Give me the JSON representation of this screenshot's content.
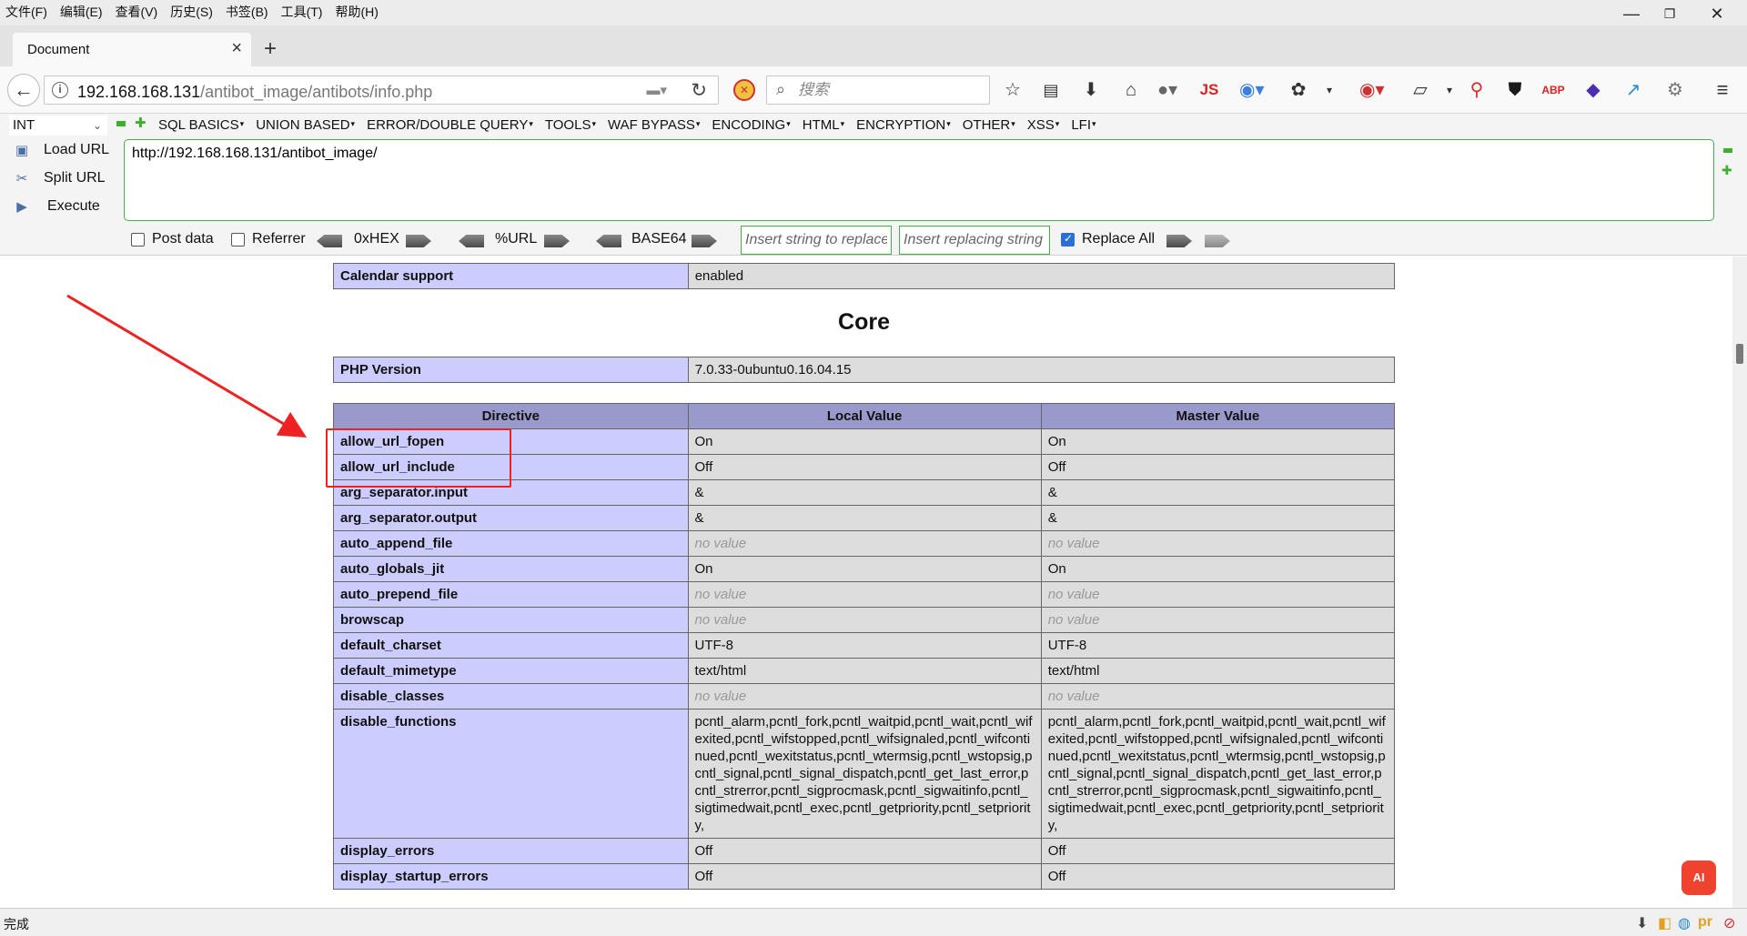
{
  "menu": [
    "文件(F)",
    "编辑(E)",
    "查看(V)",
    "历史(S)",
    "书签(B)",
    "工具(T)",
    "帮助(H)"
  ],
  "window": {
    "minimize": "—",
    "restore": "❐",
    "close": "✕"
  },
  "tab": {
    "title": "Document"
  },
  "navbar": {
    "url_host": "192.168.168.131",
    "url_path": "/antibot_image/antibots/info.php",
    "search_placeholder": "搜索",
    "js_badge": "JS"
  },
  "hackbar": {
    "select_value": "INT",
    "menus": [
      "SQL BASICS",
      "UNION BASED",
      "ERROR/DOUBLE QUERY",
      "TOOLS",
      "WAF BYPASS",
      "ENCODING",
      "HTML",
      "ENCRYPTION",
      "OTHER",
      "XSS",
      "LFI"
    ],
    "load_url": "Load URL",
    "split_url": "Split URL",
    "execute": "Execute",
    "url_value": "http://192.168.168.131/antibot_image/",
    "post_data": "Post data",
    "referrer": "Referrer",
    "hex": "0xHEX",
    "url_enc": "%URL",
    "base64": "BASE64",
    "replace_placeholder": "Insert string to replace",
    "replacing_placeholder": "Insert replacing string",
    "replace_all": "Replace All"
  },
  "content": {
    "calendar": {
      "key": "Calendar support",
      "value": "enabled"
    },
    "heading": "Core",
    "php_version": {
      "key": "PHP Version",
      "value": "7.0.33-0ubuntu0.16.04.15"
    },
    "headers": [
      "Directive",
      "Local Value",
      "Master Value"
    ],
    "rows": [
      {
        "d": "allow_url_fopen",
        "l": "On",
        "m": "On",
        "nv": false
      },
      {
        "d": "allow_url_include",
        "l": "Off",
        "m": "Off",
        "nv": false
      },
      {
        "d": "arg_separator.input",
        "l": "&",
        "m": "&",
        "nv": false
      },
      {
        "d": "arg_separator.output",
        "l": "&",
        "m": "&",
        "nv": false
      },
      {
        "d": "auto_append_file",
        "l": "no value",
        "m": "no value",
        "nv": true
      },
      {
        "d": "auto_globals_jit",
        "l": "On",
        "m": "On",
        "nv": false
      },
      {
        "d": "auto_prepend_file",
        "l": "no value",
        "m": "no value",
        "nv": true
      },
      {
        "d": "browscap",
        "l": "no value",
        "m": "no value",
        "nv": true
      },
      {
        "d": "default_charset",
        "l": "UTF-8",
        "m": "UTF-8",
        "nv": false
      },
      {
        "d": "default_mimetype",
        "l": "text/html",
        "m": "text/html",
        "nv": false
      },
      {
        "d": "disable_classes",
        "l": "no value",
        "m": "no value",
        "nv": true
      },
      {
        "d": "disable_functions",
        "l": "pcntl_alarm,pcntl_fork,pcntl_waitpid,pcntl_wait,pcntl_wifexited,pcntl_wifstopped,pcntl_wifsignaled,pcntl_wifcontinued,pcntl_wexitstatus,pcntl_wtermsig,pcntl_wstopsig,pcntl_signal,pcntl_signal_dispatch,pcntl_get_last_error,pcntl_strerror,pcntl_sigprocmask,pcntl_sigwaitinfo,pcntl_sigtimedwait,pcntl_exec,pcntl_getpriority,pcntl_setpriority,",
        "m": "pcntl_alarm,pcntl_fork,pcntl_waitpid,pcntl_wait,pcntl_wifexited,pcntl_wifstopped,pcntl_wifsignaled,pcntl_wifcontinued,pcntl_wexitstatus,pcntl_wtermsig,pcntl_wstopsig,pcntl_signal,pcntl_signal_dispatch,pcntl_get_last_error,pcntl_strerror,pcntl_sigprocmask,pcntl_sigwaitinfo,pcntl_sigtimedwait,pcntl_exec,pcntl_getpriority,pcntl_setpriority,",
        "nv": false
      },
      {
        "d": "display_errors",
        "l": "Off",
        "m": "Off",
        "nv": false
      },
      {
        "d": "display_startup_errors",
        "l": "Off",
        "m": "Off",
        "nv": false
      }
    ]
  },
  "status": {
    "text": "完成"
  },
  "colors": {
    "annotation": "#ee2222",
    "hackbar_green": "#43b04b",
    "php_key": "#ccccff",
    "php_value": "#dddddd",
    "php_header": "#9999cc"
  },
  "icons": [
    "star-icon",
    "reader-icon",
    "download-icon",
    "home-icon",
    "pocket-icon",
    "js-icon",
    "translate-icon",
    "palette-icon",
    "ublock-icon",
    "screenshot-icon",
    "zoom-icon",
    "shield-icon",
    "adblock-icon",
    "cube-icon",
    "wand-icon",
    "gear-icon",
    "hamburger-menu-icon"
  ],
  "ai_badge": "AI"
}
